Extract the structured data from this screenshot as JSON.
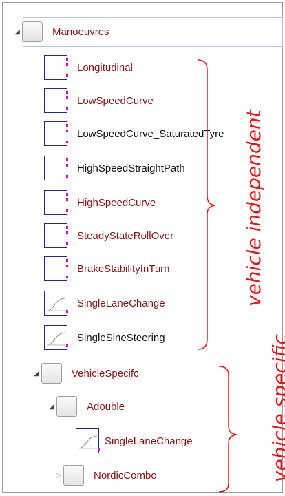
{
  "tree": {
    "root": {
      "label": "Manoeuvres",
      "expander": "◢",
      "icon": "folder-icon"
    },
    "manoeuvres": [
      {
        "label": "Longitudinal",
        "color": "#8c1010",
        "icon": "block-icon"
      },
      {
        "label": "LowSpeedCurve",
        "color": "#8c1010",
        "icon": "block-icon"
      },
      {
        "label": "LowSpeedCurve_SaturatedTyre",
        "color": "#111111",
        "icon": "block-icon"
      },
      {
        "label": "HighSpeedStraightPath",
        "color": "#111111",
        "icon": "block-icon"
      },
      {
        "label": "HighSpeedCurve",
        "color": "#8c1010",
        "icon": "block-icon"
      },
      {
        "label": "SteadyStateRollOver",
        "color": "#8c1010",
        "icon": "block-icon"
      },
      {
        "label": "BrakeStabilityInTurn",
        "color": "#8c1010",
        "icon": "block-icon"
      },
      {
        "label": "SingleLaneChange",
        "color": "#8c1010",
        "icon": "curve-block-icon"
      },
      {
        "label": "SingleSineSteering",
        "color": "#111111",
        "icon": "curve-block-icon"
      }
    ],
    "vehicle_specific": {
      "label": "VehicleSpecifc",
      "expander": "◢"
    },
    "adouble": {
      "label": "Adouble",
      "expander": "◢"
    },
    "adouble_child": {
      "label": "SingleLaneChange"
    },
    "nordic": {
      "label": "NordicCombo",
      "expander": "▷"
    }
  },
  "annotations": {
    "vehicle_independent": "vehicle independent",
    "vehicle_specific": "vehicle specific"
  },
  "colors": {
    "annotation": "#ee1111",
    "label_red": "#8c1010",
    "block_border": "#1c2a86",
    "port": "#d400d4"
  }
}
